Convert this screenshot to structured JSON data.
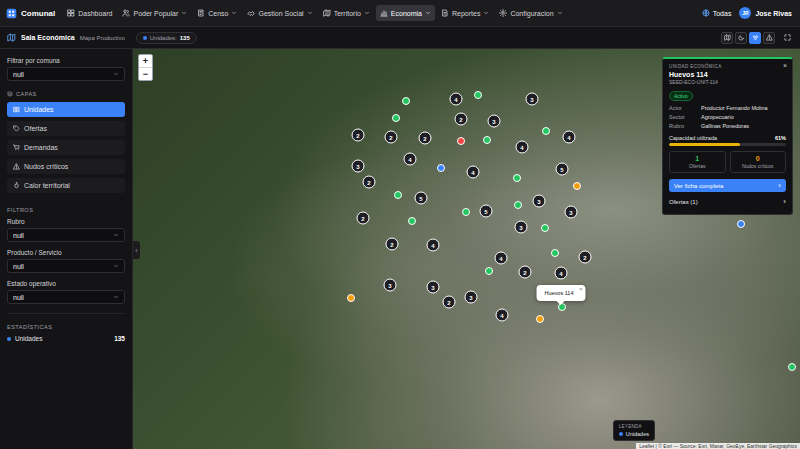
{
  "app": {
    "name": "Comunal"
  },
  "nav": [
    {
      "label": "Dashboard",
      "kind": "dashboard",
      "has_menu": false,
      "selected": false
    },
    {
      "label": "Poder Popular",
      "kind": "people",
      "has_menu": true,
      "selected": false
    },
    {
      "label": "Censo",
      "kind": "census",
      "has_menu": true,
      "selected": false
    },
    {
      "label": "Gestion Social",
      "kind": "hands",
      "has_menu": true,
      "selected": false
    },
    {
      "label": "Territorio",
      "kind": "territory",
      "has_menu": true,
      "selected": false
    },
    {
      "label": "Economia",
      "kind": "economy",
      "has_menu": true,
      "selected": true
    },
    {
      "label": "Reportes",
      "kind": "report",
      "has_menu": true,
      "selected": false
    },
    {
      "label": "Configuracion",
      "kind": "settings",
      "has_menu": true,
      "selected": false
    }
  ],
  "user": {
    "scope": "Todas",
    "initials": "JR",
    "name": "Jose Rivas"
  },
  "page": {
    "title": "Sala Económica",
    "subtitle": "Mapa Productivo",
    "counter_label": "Unidades:",
    "counter_value": "135"
  },
  "toolbar": [
    {
      "kind": "map",
      "selected": false
    },
    {
      "kind": "moon",
      "selected": false
    },
    {
      "kind": "cluster",
      "selected": true
    },
    {
      "kind": "alert",
      "selected": false
    },
    {
      "kind": "expand",
      "selected": false
    }
  ],
  "sidebar": {
    "comuna_label": "Filtrar por comuna",
    "comuna_value": "null",
    "layers_heading": "CAPAS",
    "layers": [
      {
        "label": "Unidades",
        "kind": "grid",
        "selected": true
      },
      {
        "label": "Ofertas",
        "kind": "offer",
        "selected": false
      },
      {
        "label": "Demandas",
        "kind": "demand",
        "selected": false
      },
      {
        "label": "Nudos críticos",
        "kind": "alert",
        "selected": false
      },
      {
        "label": "Calor territorial",
        "kind": "heat",
        "selected": false
      }
    ],
    "filters_heading": "FILTROS",
    "filters": [
      {
        "label": "Rubro",
        "value": "null"
      },
      {
        "label": "Producto / Servicio",
        "value": "null"
      },
      {
        "label": "Estado operativo",
        "value": "null"
      }
    ],
    "stats_heading": "ESTADÍSTICAS",
    "stats": [
      {
        "label": "Unidades",
        "value": "135",
        "color": "#3b82f6"
      }
    ]
  },
  "map": {
    "zoom": [
      "+",
      "−"
    ],
    "collapse": "‹",
    "clusters": [
      {
        "label": "4"
      },
      {
        "label": "3"
      },
      {
        "label": "2"
      },
      {
        "label": "3"
      },
      {
        "label": "2"
      },
      {
        "label": "2"
      },
      {
        "label": "2"
      },
      {
        "label": "4"
      },
      {
        "label": "4"
      },
      {
        "label": "4"
      },
      {
        "label": "3"
      },
      {
        "label": "4"
      },
      {
        "label": "5"
      },
      {
        "label": "2"
      },
      {
        "label": "5"
      },
      {
        "label": "3"
      },
      {
        "label": "5"
      },
      {
        "label": "3"
      },
      {
        "label": "2"
      },
      {
        "label": "3"
      },
      {
        "label": "2"
      },
      {
        "label": "4"
      },
      {
        "label": "2"
      },
      {
        "label": "4"
      },
      {
        "label": "2"
      },
      {
        "label": "4"
      },
      {
        "label": "3"
      },
      {
        "label": "3"
      },
      {
        "label": "2"
      },
      {
        "label": "3"
      },
      {
        "label": "4"
      }
    ],
    "points": [
      {
        "color": "#22c55e"
      },
      {
        "color": "#22c55e"
      },
      {
        "color": "#22c55e"
      },
      {
        "color": "#22c55e"
      },
      {
        "color": "#22c55e"
      },
      {
        "color": "#22c55e"
      },
      {
        "color": "#22c55e"
      },
      {
        "color": "#22c55e"
      },
      {
        "color": "#22c55e"
      },
      {
        "color": "#22c55e"
      },
      {
        "color": "#22c55e"
      },
      {
        "color": "#22c55e"
      },
      {
        "color": "#22c55e"
      },
      {
        "color": "#22c55e"
      },
      {
        "color": "#22c55e"
      },
      {
        "color": "#f59e0b"
      },
      {
        "color": "#f59e0b"
      },
      {
        "color": "#f59e0b"
      },
      {
        "color": "#3b82f6"
      },
      {
        "color": "#3b82f6"
      },
      {
        "color": "#ef4444"
      }
    ],
    "popup": {
      "title": "Huevos 114",
      "close": "×"
    },
    "legend": {
      "title": "LEYENDA",
      "items": [
        {
          "label": "Unidades",
          "color": "#3b82f6"
        }
      ]
    },
    "attribution": "Leaflet | © Esri — Source: Esri, Maxar, GeoEye, Earthstar Geographics"
  },
  "detail": {
    "eyebrow": "UNIDAD ECONÓMICA",
    "title": "Huevos 114",
    "code": "SEED-ECO-UNIT-114",
    "close": "×",
    "status": "Activo",
    "fields": [
      {
        "label": "Actor",
        "value": "Productor Fernando Molina"
      },
      {
        "label": "Sector",
        "value": "Agropecuario"
      },
      {
        "label": "Rubro",
        "value": "Gallinas Ponedoras"
      }
    ],
    "capacity": {
      "label": "Capacidad utilizada",
      "reading": "61%",
      "level": 0.61
    },
    "stats": [
      {
        "value": "1",
        "label": "Ofertas",
        "color": "#22c55e"
      },
      {
        "value": "0",
        "label": "Nudos críticos",
        "color": "#f59e0b"
      }
    ],
    "primary_action": {
      "label": "Ver ficha completa",
      "arrow": "›"
    },
    "sections": [
      {
        "label": "Ofertas (1)",
        "arrow": "›"
      }
    ]
  }
}
